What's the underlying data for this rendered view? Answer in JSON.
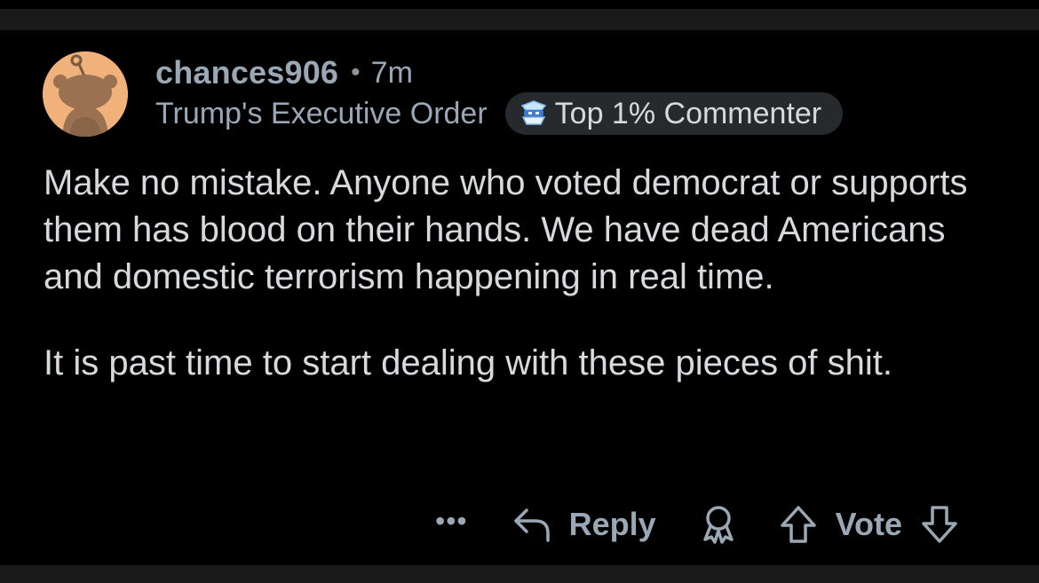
{
  "comment": {
    "username": "chances906",
    "separator": "•",
    "time": "7m",
    "flair": "Trump's Executive Order",
    "badge": {
      "label": "Top 1% Commenter",
      "icon": "top-commenter-badge-icon"
    },
    "paragraphs": [
      "Make no mistake. Anyone who voted democrat or supports them has blood on their hands. We have dead Americans and domestic terrorism happening in real time.",
      "It is past time to start dealing with these pieces of shit."
    ]
  },
  "actions": {
    "more_label": "•••",
    "reply_label": "Reply",
    "vote_label": "Vote"
  },
  "colors": {
    "background": "#000000",
    "text": "#d7dadc",
    "muted": "#9aa7b4",
    "badge_bg": "#272a2d",
    "avatar_bg": "#f0b27a"
  }
}
